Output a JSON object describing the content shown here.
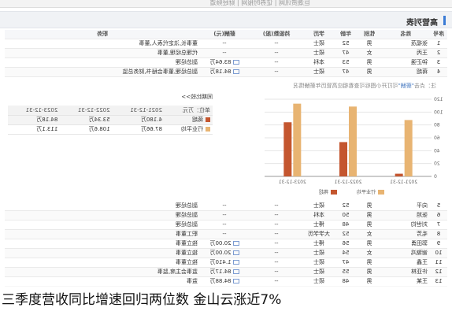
{
  "header": {
    "breadcrumb": "巨潮资讯网 | 证券时报网 | 财经频道",
    "section_title": "高管列表"
  },
  "columns": [
    "序号",
    "姓名",
    "性别",
    "年龄",
    "学历",
    "持股数(股)",
    "薪酬(元)",
    "职务"
  ],
  "top_rows": [
    {
      "idx": "1",
      "name": "张福茂",
      "gender": "男",
      "age": "52",
      "edu": "硕士",
      "shares": "--",
      "salary": "--",
      "title": "董事长,法定代表人,董事"
    },
    {
      "idx": "2",
      "name": "王丙",
      "gender": "女",
      "age": "47",
      "edu": "硕士",
      "shares": "--",
      "salary": "--",
      "title": "代理总经理,董事"
    },
    {
      "idx": "3",
      "name": "钟正强",
      "gender": "男",
      "age": "53",
      "edu": "本科",
      "shares": "--",
      "salary": "83.64万",
      "title": "副总经理"
    },
    {
      "idx": "4",
      "name": "蒋超",
      "gender": "男",
      "age": "47",
      "edu": "硕士",
      "shares": "--",
      "salary": "84.18万",
      "title": "副总经理,董事会秘书,财务总监"
    }
  ],
  "note": {
    "prefix": "注：点击",
    "link": "\"薪酬\"",
    "suffix": "可打开小图标可查看相应高管历年薪酬情况"
  },
  "compare": {
    "title": "同期比较>>",
    "unit": "单位：万元",
    "years": [
      "2021-12-31",
      "2022-12-31",
      "2023-12-31"
    ],
    "rows": [
      {
        "label": "蒋超",
        "values": [
          "4.180万",
          "53.34万",
          "84.18万"
        ]
      },
      {
        "label": "行业平均",
        "values": [
          "87.66万",
          "108.6万",
          "113.1万"
        ]
      }
    ]
  },
  "chart_data": {
    "type": "bar",
    "categories": [
      "2021-12-31",
      "2022-12-31",
      "2023-12-31"
    ],
    "series": [
      {
        "name": "行业平均",
        "values": [
          87.66,
          108.6,
          113.1
        ],
        "color": "#e8b472"
      },
      {
        "name": "蒋超",
        "values": [
          4.18,
          53.34,
          84.18
        ],
        "color": "#c4562f"
      }
    ],
    "yticks": [
      0,
      20,
      40,
      60,
      80,
      100,
      120
    ],
    "ylim": [
      0,
      120
    ],
    "ylabel": "万元"
  },
  "bottom_rows": [
    {
      "idx": "5",
      "name": "向平",
      "gender": "男",
      "age": "52",
      "edu": "硕士",
      "shares": "--",
      "salary": "--",
      "title": "副总经理"
    },
    {
      "idx": "6",
      "name": "张旭",
      "gender": "男",
      "age": "50",
      "edu": "本科",
      "shares": "--",
      "salary": "--",
      "title": "副总经理"
    },
    {
      "idx": "7",
      "name": "刘世钧",
      "gender": "男",
      "age": "48",
      "edu": "博士",
      "shares": "--",
      "salary": "--",
      "title": "副总经理"
    },
    {
      "idx": "8",
      "name": "毛芳",
      "gender": "女",
      "age": "52",
      "edu": "大学学历",
      "shares": "--",
      "salary": "--",
      "title": "职工董事"
    },
    {
      "idx": "9",
      "name": "郭田勇",
      "gender": "男",
      "age": "56",
      "edu": "博士",
      "shares": "--",
      "salary": "20.00万",
      "title": "独立董事"
    },
    {
      "idx": "10",
      "name": "谢璐鸿",
      "gender": "女",
      "age": "54",
      "edu": "硕士",
      "shares": "--",
      "salary": "20.00万",
      "title": "独立董事"
    },
    {
      "idx": "11",
      "name": "王鑫",
      "gender": "男",
      "age": "47",
      "edu": "硕士",
      "shares": "--",
      "salary": "1.410万",
      "title": "独立董事"
    },
    {
      "idx": "12",
      "name": "许亚林",
      "gender": "男",
      "age": "55",
      "edu": "硕士",
      "shares": "--",
      "salary": "84.17万",
      "title": "监事会主席,监事"
    },
    {
      "idx": "13",
      "name": "王某",
      "gender": "男",
      "age": "48",
      "edu": "硕士",
      "shares": "--",
      "salary": "84.88万",
      "title": "监事"
    }
  ],
  "caption": "三季度营收同比增速回归两位数 金山云涨近7%"
}
